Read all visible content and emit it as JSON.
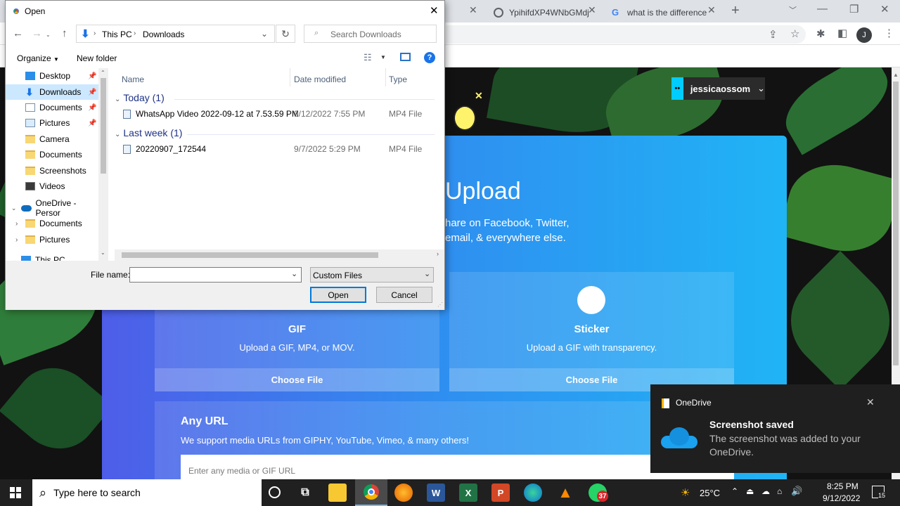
{
  "chrome": {
    "tabs": [
      {
        "label": "YpihifdXP4WNbGMdj",
        "close": "✕"
      },
      {
        "label": "what is the difference",
        "close": "✕"
      }
    ],
    "new_tab": "+",
    "profile_initial": "J"
  },
  "site": {
    "username": "jessicaossom",
    "upload_title": "Upload",
    "upload_desc_line1": "hare on Facebook, Twitter,",
    "upload_desc_line2": "email, & everywhere else.",
    "gif_card": {
      "title": "GIF",
      "desc": "Upload a GIF, MP4, or MOV.",
      "button": "Choose File"
    },
    "sticker_card": {
      "title": "Sticker",
      "desc": "Upload a GIF with transparency.",
      "button": "Choose File"
    },
    "any_url": {
      "title": "Any URL",
      "desc": "We support media URLs from GIPHY, YouTube, Vimeo, & many others!",
      "placeholder": "Enter any media or GIF URL"
    }
  },
  "dialog": {
    "title": "Open",
    "breadcrumb": [
      "This PC",
      "Downloads"
    ],
    "search_placeholder": "Search Downloads",
    "organize": "Organize",
    "new_folder": "New folder",
    "nav_items": [
      {
        "label": "Desktop",
        "pinned": true
      },
      {
        "label": "Downloads",
        "pinned": true,
        "selected": true
      },
      {
        "label": "Documents",
        "pinned": true
      },
      {
        "label": "Pictures",
        "pinned": true
      },
      {
        "label": "Camera"
      },
      {
        "label": "Documents"
      },
      {
        "label": "Screenshots"
      },
      {
        "label": "Videos"
      },
      {
        "label": "OneDrive - Persor"
      },
      {
        "label": "Documents"
      },
      {
        "label": "Pictures"
      },
      {
        "label": "This PC"
      }
    ],
    "columns": {
      "name": "Name",
      "date": "Date modified",
      "type": "Type"
    },
    "groups": [
      {
        "label": "Today (1)",
        "files": [
          {
            "name": "WhatsApp Video 2022-09-12 at 7.53.59 PM",
            "date": "9/12/2022 7:55 PM",
            "type": "MP4 File"
          }
        ]
      },
      {
        "label": "Last week (1)",
        "files": [
          {
            "name": "20220907_172544",
            "date": "9/7/2022 5:29 PM",
            "type": "MP4 File"
          }
        ]
      }
    ],
    "file_name_label": "File name:",
    "file_name_value": "",
    "filter": "Custom Files",
    "open_button": "Open",
    "cancel_button": "Cancel"
  },
  "toast": {
    "app": "OneDrive",
    "title": "Screenshot saved",
    "body": "The screenshot was added to your OneDrive."
  },
  "taskbar": {
    "search_placeholder": "Type here to search",
    "whatsapp_badge": "37",
    "weather": "25°C",
    "time": "8:25 PM",
    "date": "9/12/2022",
    "notification_count": "15"
  }
}
